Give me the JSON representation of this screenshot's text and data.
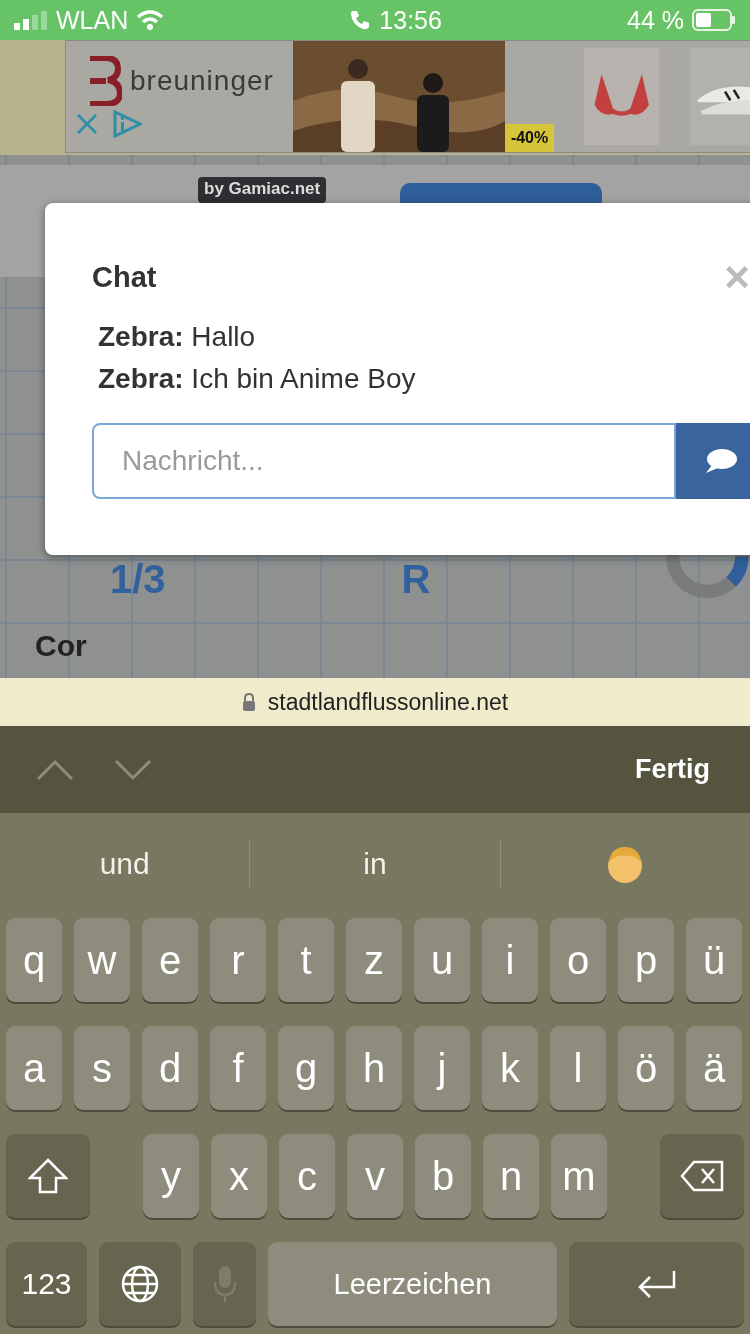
{
  "status_bar": {
    "network": "WLAN",
    "time": "13:56",
    "battery": "44 %"
  },
  "ad": {
    "brand": "breuninger",
    "discount": "-40%"
  },
  "page": {
    "badge": "by Gamiac.net",
    "round": "1/3",
    "letter": "R",
    "label_fragment": "Cor"
  },
  "chat": {
    "title": "Chat",
    "close": "×",
    "messages": [
      {
        "sender": "Zebra:",
        "text": "Hallo"
      },
      {
        "sender": "Zebra:",
        "text": "Ich bin Anime Boy"
      }
    ],
    "input": {
      "placeholder": "Nachricht..."
    }
  },
  "url_bar": {
    "url": "stadtlandflussonline.net"
  },
  "keyboard": {
    "done": "Fertig",
    "suggestions": [
      {
        "kind": "text",
        "label": "und"
      },
      {
        "kind": "text",
        "label": "in"
      },
      {
        "kind": "emoji"
      }
    ],
    "key_rows": [
      {
        "letters": [
          "q",
          "w",
          "e",
          "r",
          "t",
          "z",
          "u",
          "i",
          "o",
          "p",
          "ü"
        ]
      },
      {
        "letters": [
          "a",
          "s",
          "d",
          "f",
          "g",
          "h",
          "j",
          "k",
          "l",
          "ö",
          "ä"
        ]
      },
      {
        "letters": [
          "y",
          "x",
          "c",
          "v",
          "b",
          "n",
          "m"
        ]
      }
    ],
    "numbers_key": "123",
    "space_key": "Leerzeichen"
  }
}
